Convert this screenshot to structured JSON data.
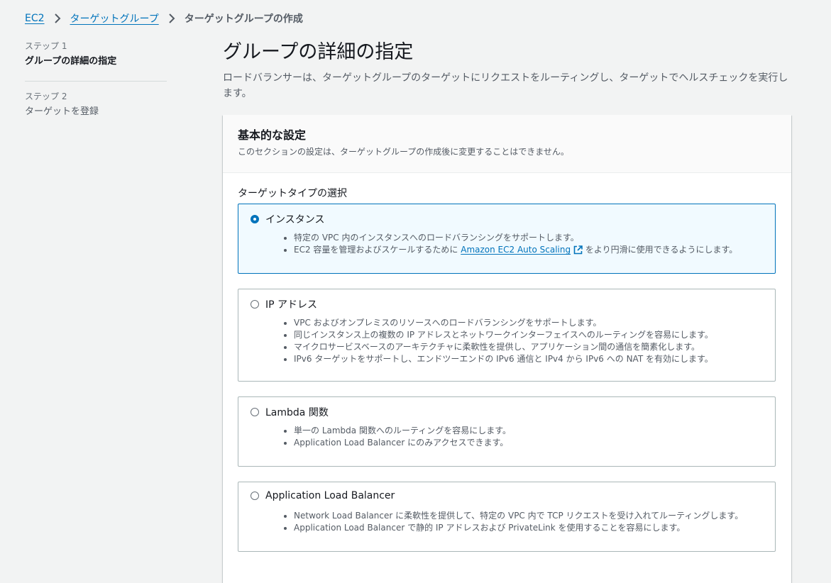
{
  "breadcrumb": {
    "items": [
      "EC2",
      "ターゲットグループ"
    ],
    "current": "ターゲットグループの作成"
  },
  "steps": [
    {
      "label": "ステップ 1",
      "title": "グループの詳細の指定",
      "active": true
    },
    {
      "label": "ステップ 2",
      "title": "ターゲットを登録",
      "active": false
    }
  ],
  "page": {
    "title": "グループの詳細の指定",
    "description": "ロードバランサーは、ターゲットグループのターゲットにリクエストをルーティングし、ターゲットでヘルスチェックを実行します。"
  },
  "panel": {
    "title": "基本的な設定",
    "subtitle": "このセクションの設定は、ターゲットグループの作成後に変更することはできません。",
    "field_label": "ターゲットタイプの選択"
  },
  "target_types": [
    {
      "label": "インスタンス",
      "selected": true,
      "bullets": [
        "特定の VPC 内のインスタンスへのロードバランシングをサポートします。"
      ],
      "bullet_with_link": {
        "before": "EC2 容量を管理およびスケールするために ",
        "link": "Amazon EC2 Auto Scaling",
        "after": " をより円滑に使用できるようにします。"
      }
    },
    {
      "label": "IP アドレス",
      "selected": false,
      "bullets": [
        "VPC およびオンプレミスのリソースへのロードバランシングをサポートします。",
        "同じインスタンス上の複数の IP アドレスとネットワークインターフェイスへのルーティングを容易にします。",
        "マイクロサービスベースのアーキテクチャに柔軟性を提供し、アプリケーション間の通信を簡素化します。",
        "IPv6 ターゲットをサポートし、エンドツーエンドの IPv6 通信と IPv4 から IPv6 への NAT を有効にします。"
      ]
    },
    {
      "label": "Lambda 関数",
      "selected": false,
      "bullets": [
        "単一の Lambda 関数へのルーティングを容易にします。",
        "Application Load Balancer にのみアクセスできます。"
      ]
    },
    {
      "label": "Application Load Balancer",
      "selected": false,
      "bullets": [
        "Network Load Balancer に柔軟性を提供して、特定の VPC 内で TCP リクエストを受け入れてルーティングします。",
        "Application Load Balancer で静的 IP アドレスおよび PrivateLink を使用することを容易にします。"
      ]
    }
  ],
  "icons": {
    "breadcrumb_separator": "chevron-right-icon",
    "external_link": "external-link-icon"
  },
  "colors": {
    "accent": "#0073bb",
    "selected_bg": "#f1faff",
    "page_bg": "#f2f3f3"
  }
}
